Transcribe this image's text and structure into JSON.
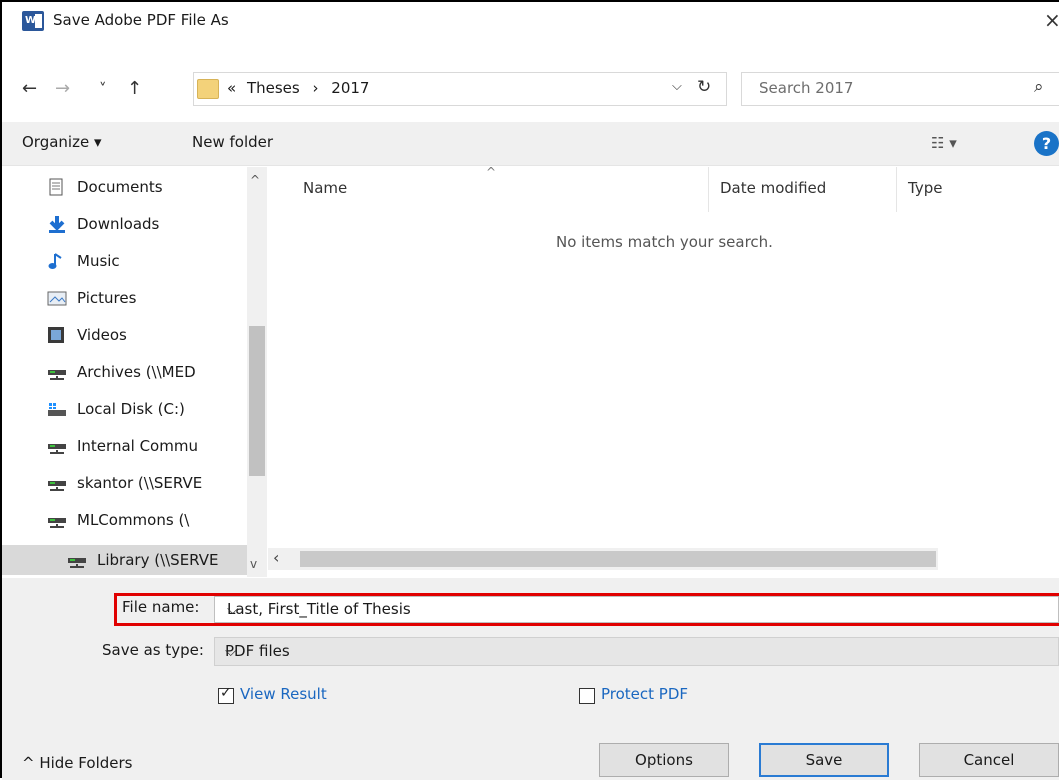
{
  "window": {
    "title": "Save Adobe PDF File As",
    "close_glyph": "×"
  },
  "address": {
    "path": [
      "Theses",
      "2017"
    ],
    "prefix": "«",
    "separator": "›",
    "search_placeholder": "Search 2017"
  },
  "nav_glyphs": {
    "back": "←",
    "forward": "→",
    "history": "˅",
    "up": "↑"
  },
  "toolbar": {
    "organize_label": "Organize ▾",
    "new_folder_label": "New folder"
  },
  "navpane": {
    "items": [
      {
        "label": "Documents",
        "icon": "documents-icon"
      },
      {
        "label": "Downloads",
        "icon": "downloads-icon"
      },
      {
        "label": "Music",
        "icon": "music-icon"
      },
      {
        "label": "Pictures",
        "icon": "pictures-icon"
      },
      {
        "label": "Videos",
        "icon": "videos-icon"
      },
      {
        "label": "Archives (\\\\MED",
        "icon": "network-drive-icon"
      },
      {
        "label": "Local Disk (C:)",
        "icon": "local-disk-icon"
      },
      {
        "label": "Internal Commu",
        "icon": "network-drive-icon"
      },
      {
        "label": "skantor (\\\\SERVE",
        "icon": "network-drive-icon"
      },
      {
        "label": "MLCommons (\\",
        "icon": "network-drive-icon"
      },
      {
        "label": "Library (\\\\SERVE",
        "icon": "network-drive-icon",
        "selected": true
      }
    ]
  },
  "filelist": {
    "columns": {
      "name": "Name",
      "date": "Date modified",
      "type": "Type"
    },
    "empty_message": "No items match your search."
  },
  "form": {
    "file_name_label": "File name:",
    "file_name_value": "Last, First_Title of Thesis",
    "save_type_label": "Save as type:",
    "save_type_value": "PDF files",
    "view_result_label": "View Result",
    "view_result_checked": true,
    "protect_pdf_label": "Protect PDF",
    "protect_pdf_checked": false
  },
  "footer": {
    "hide_folders_label": "^ Hide Folders",
    "options_label": "Options",
    "save_label": "Save",
    "cancel_label": "Cancel"
  },
  "colors": {
    "highlight": "#e00000",
    "link": "#1a67c0",
    "accent": "#2a7bd3",
    "word_brand": "#2b579a"
  }
}
